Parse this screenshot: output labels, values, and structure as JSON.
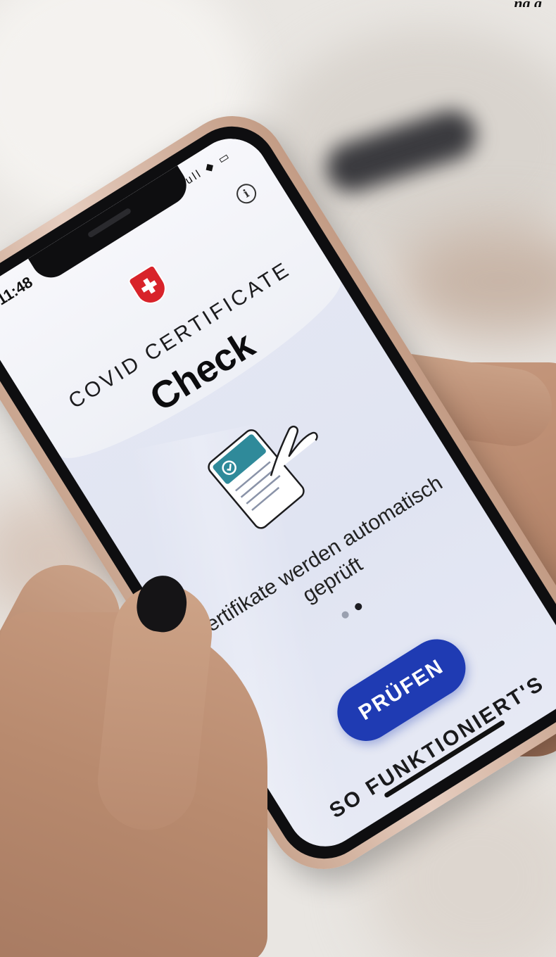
{
  "photo": {
    "caption_fragment": "ng g"
  },
  "status_bar": {
    "time": "11:48",
    "icons": "ull ◆ ▭"
  },
  "header": {
    "info_symbol": "i",
    "subtitle": "COVID CERTIFICATE",
    "title": "Check"
  },
  "content": {
    "description": "Zertifikate werden automatisch geprüft",
    "pager_count": 2,
    "pager_active": 2
  },
  "actions": {
    "check_label": "PRÜFEN",
    "how_label": "SO FUNKTIONIERT'S"
  },
  "colors": {
    "primary_button": "#1f3bb3",
    "flag_red": "#d8232a",
    "illustration_teal": "#2f8a9a"
  }
}
